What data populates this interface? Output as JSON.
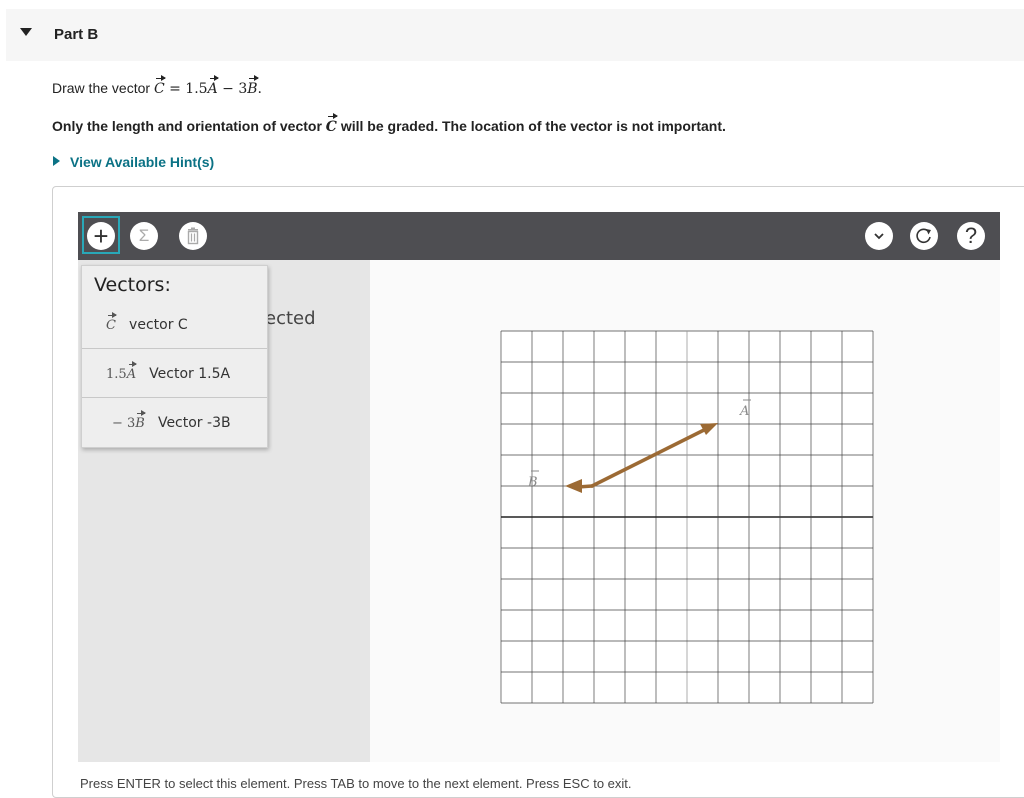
{
  "part": {
    "title": "Part B"
  },
  "question": {
    "prefix": "Draw the vector ",
    "vec_c": "C",
    "equation_mid": " = 1.5",
    "vec_a": "A",
    "minus": " − 3",
    "vec_b": "B",
    "suffix": "."
  },
  "note": {
    "before": "Only the length and orientation of vector ",
    "vec": "C",
    "after": " will be graded. The location of the vector is not important."
  },
  "hint": {
    "label": "View Available Hint(s)"
  },
  "toolbar": {
    "add_glyph": "+",
    "sum_glyph": "Σ",
    "help_glyph": "?"
  },
  "menu": {
    "heading": "Vectors:",
    "items": [
      {
        "symbol_vec": "C",
        "label": "vector C"
      },
      {
        "symbol_prefix": "1.5",
        "symbol_vec": "A",
        "label": "Vector 1.5A"
      },
      {
        "symbol_prefix": "− 3",
        "symbol_vec": "B",
        "label": "Vector -3B"
      }
    ]
  },
  "canvas": {
    "partial_label": "ected",
    "label_a": "A",
    "label_b": "B",
    "arrow_color": "#9c6a34"
  },
  "footer": {
    "text": "Press ENTER to select this element. Press TAB to move to the next element. Press ESC to exit."
  },
  "colors": {
    "accent": "#29a8b8",
    "toolbar": "#4e4e52",
    "link": "#0b7285"
  }
}
